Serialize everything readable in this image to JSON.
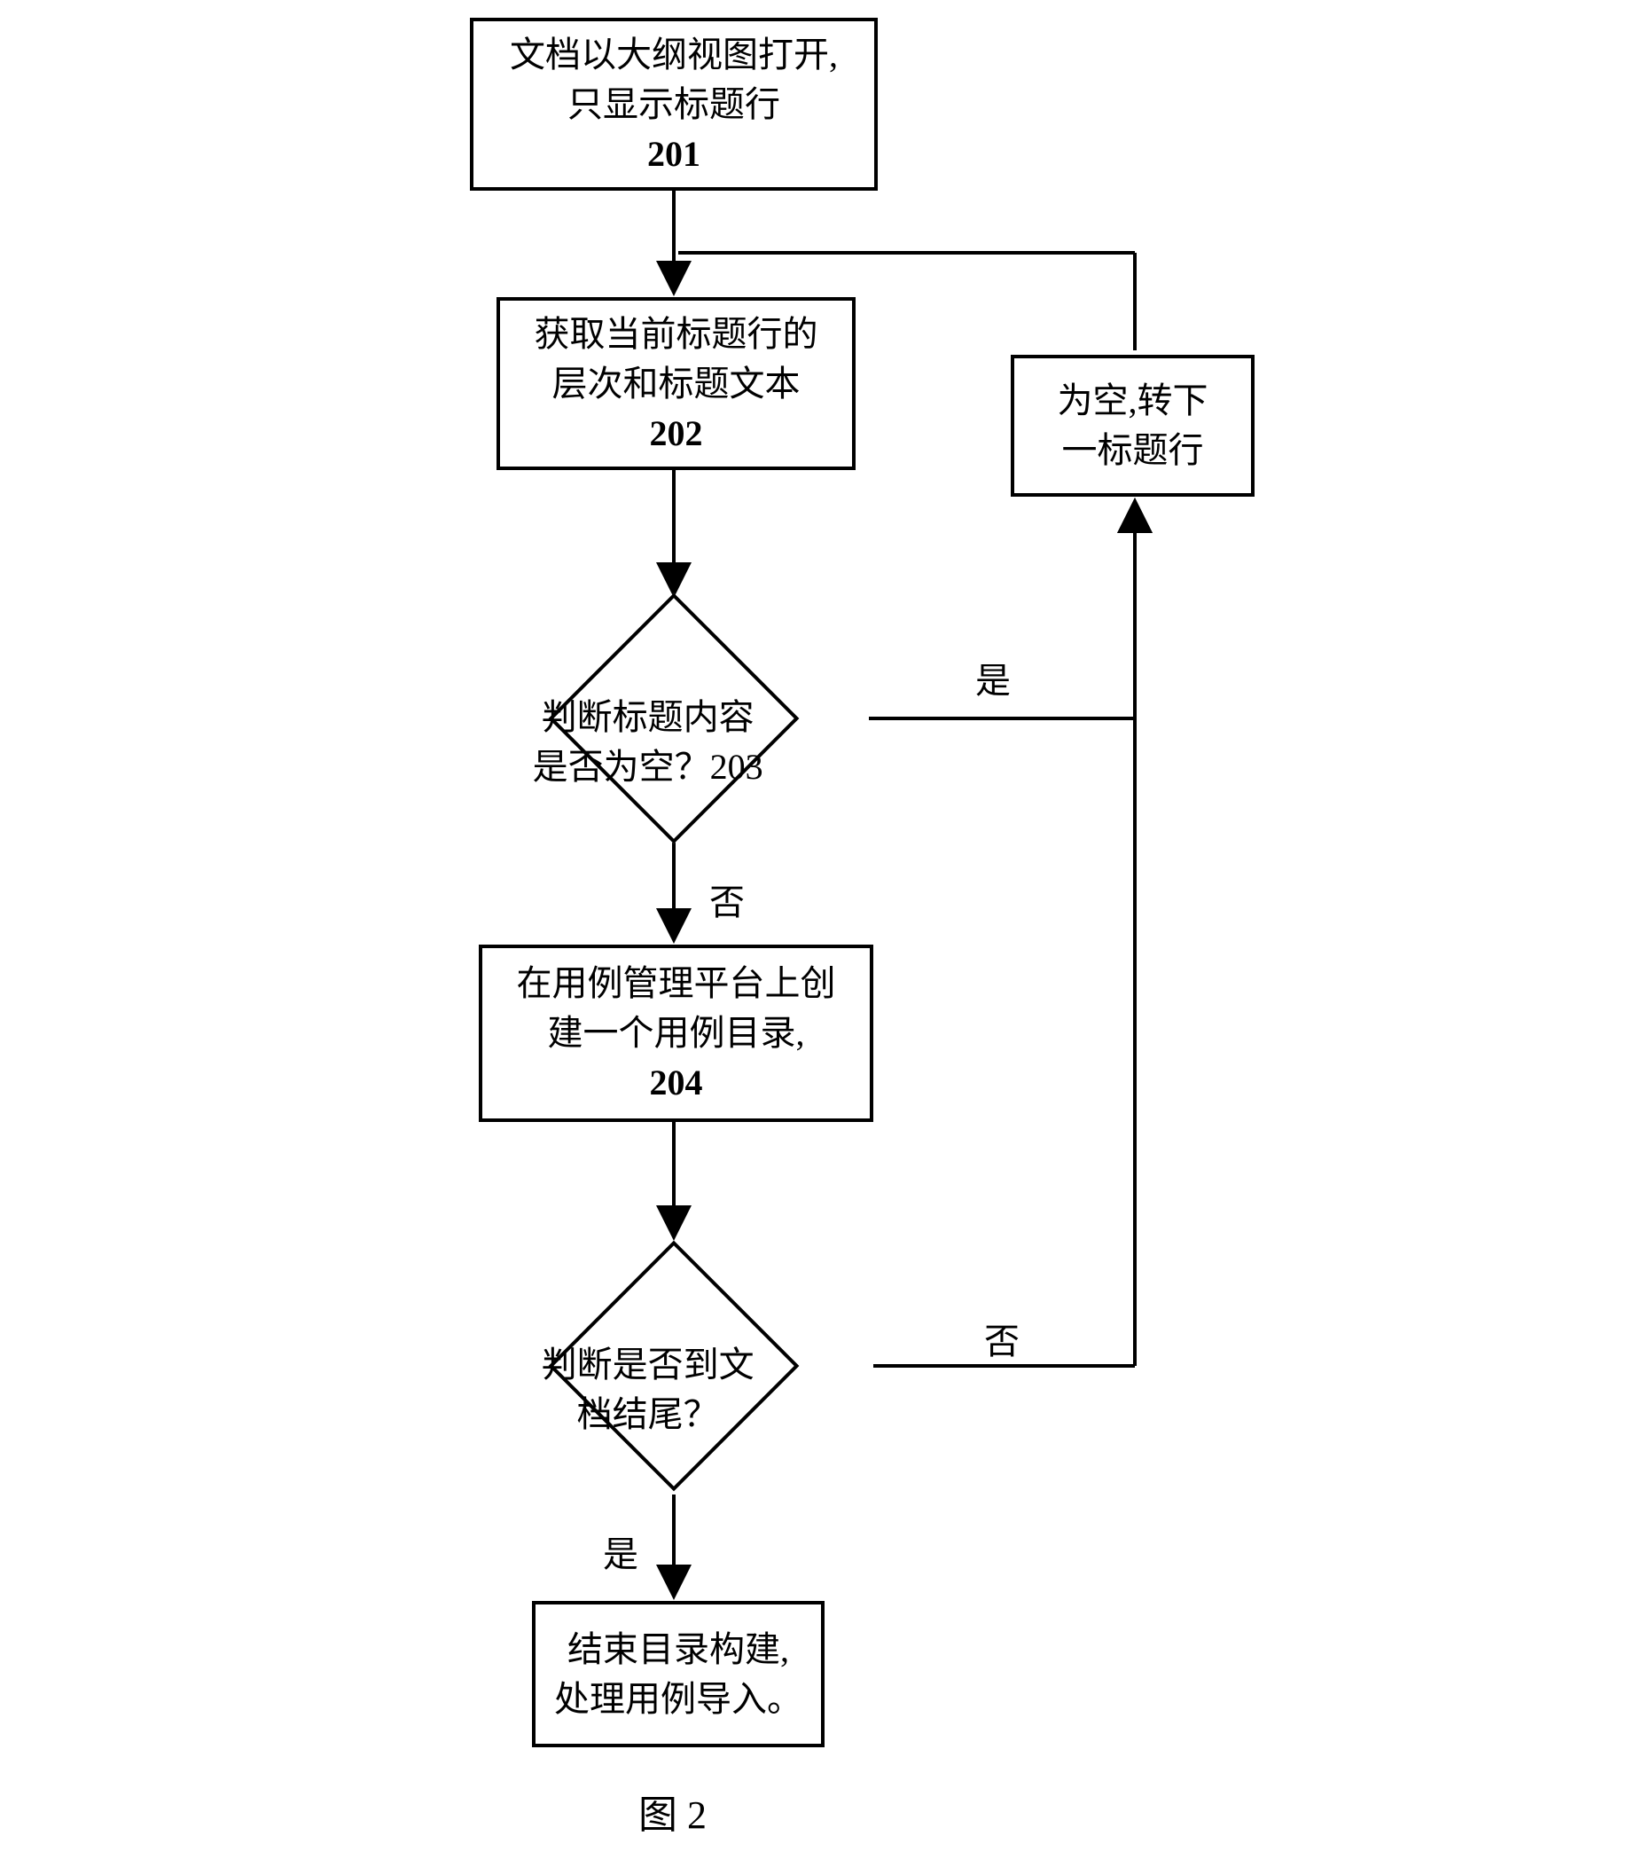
{
  "chart_data": {
    "type": "flowchart",
    "title": "图 2",
    "nodes": [
      {
        "id": "201",
        "type": "process",
        "line1": "文档以大纲视图打开,",
        "line2": "只显示标题行",
        "line3": "201"
      },
      {
        "id": "202",
        "type": "process",
        "line1": "获取当前标题行的",
        "line2": "层次和标题文本",
        "line3": "202"
      },
      {
        "id": "203",
        "type": "decision",
        "text": "判断标题内容是否为空？203"
      },
      {
        "id": "side",
        "type": "process",
        "line1": "为空,转下",
        "line2": "一标题行"
      },
      {
        "id": "204",
        "type": "process",
        "line1": "在用例管理平台上创",
        "line2": "建一个用例目录,",
        "line3": "204"
      },
      {
        "id": "d2",
        "type": "decision",
        "text": "判断是否到文档结尾？"
      },
      {
        "id": "end",
        "type": "process",
        "line1": "结束目录构建,",
        "line2": "处理用例导入。"
      }
    ],
    "edges": [
      {
        "from": "201",
        "to": "202"
      },
      {
        "from": "202",
        "to": "203"
      },
      {
        "from": "203",
        "to": "side",
        "label": "是"
      },
      {
        "from": "203",
        "to": "204",
        "label": "否"
      },
      {
        "from": "204",
        "to": "d2"
      },
      {
        "from": "d2",
        "to": "end",
        "label": "是"
      },
      {
        "from": "d2",
        "to": "202",
        "label": "否",
        "via": "side"
      },
      {
        "from": "side",
        "to": "202"
      }
    ],
    "labels": {
      "yes1": "是",
      "no1": "否",
      "yes2": "是",
      "no2": "否"
    }
  }
}
